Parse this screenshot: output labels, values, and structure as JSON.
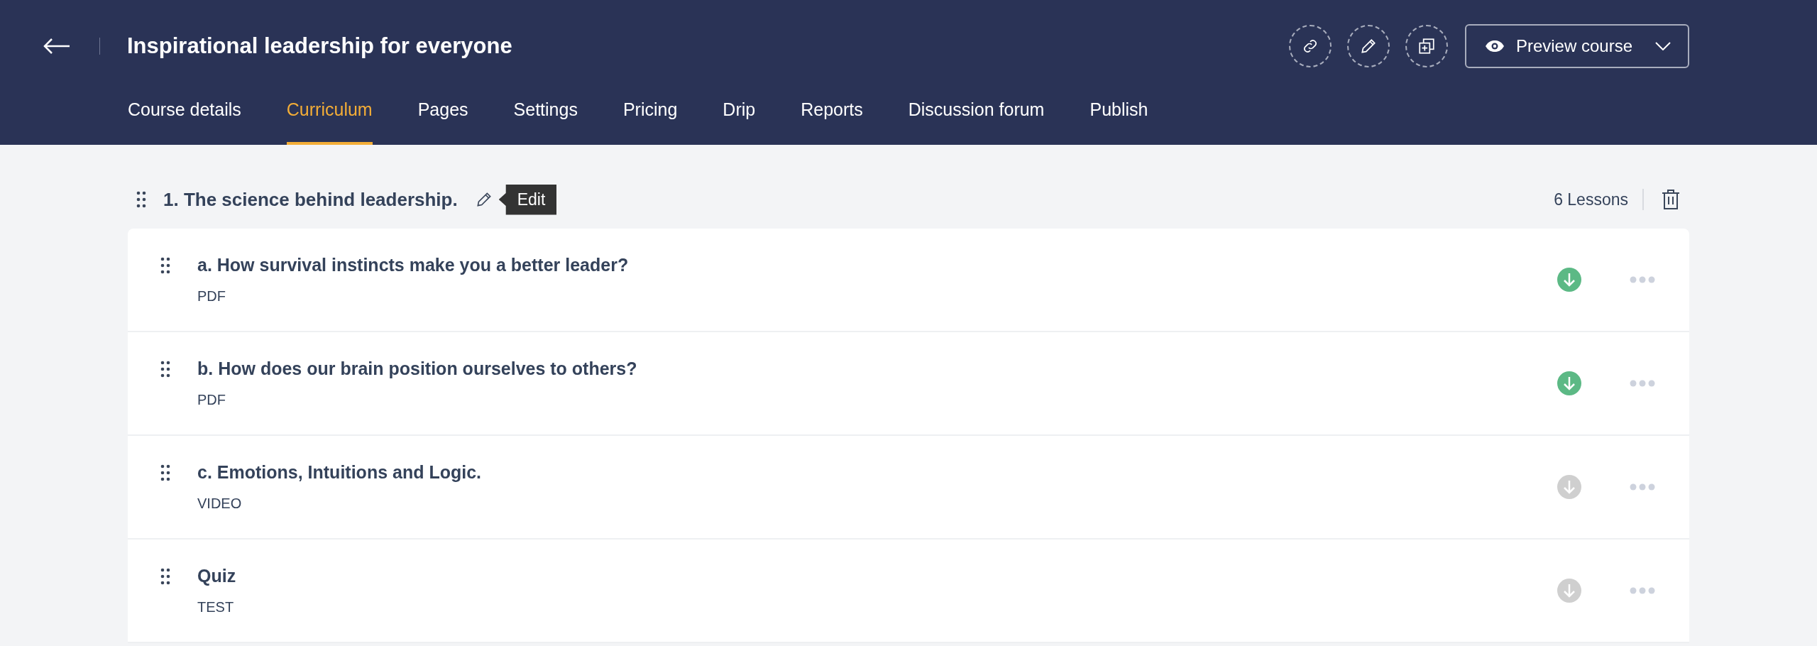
{
  "header": {
    "title": "Inspirational leadership for everyone",
    "preview_button": "Preview course"
  },
  "tabs": [
    {
      "label": "Course details",
      "selected": false
    },
    {
      "label": "Curriculum",
      "selected": true
    },
    {
      "label": "Pages",
      "selected": false
    },
    {
      "label": "Settings",
      "selected": false
    },
    {
      "label": "Pricing",
      "selected": false
    },
    {
      "label": "Drip",
      "selected": false
    },
    {
      "label": "Reports",
      "selected": false
    },
    {
      "label": "Discussion forum",
      "selected": false
    },
    {
      "label": "Publish",
      "selected": false
    }
  ],
  "section": {
    "title": "1. The science behind leadership.",
    "tooltip": "Edit",
    "lesson_count": "6 Lessons",
    "lessons": [
      {
        "title": "a. How survival instincts make you a better leader?",
        "type": "PDF",
        "downloadable": true
      },
      {
        "title": "b. How does our brain position ourselves to others?",
        "type": "PDF",
        "downloadable": true
      },
      {
        "title": "c. Emotions, Intuitions and Logic.",
        "type": "VIDEO",
        "downloadable": false
      },
      {
        "title": "Quiz",
        "type": "TEST",
        "downloadable": false
      }
    ]
  }
}
